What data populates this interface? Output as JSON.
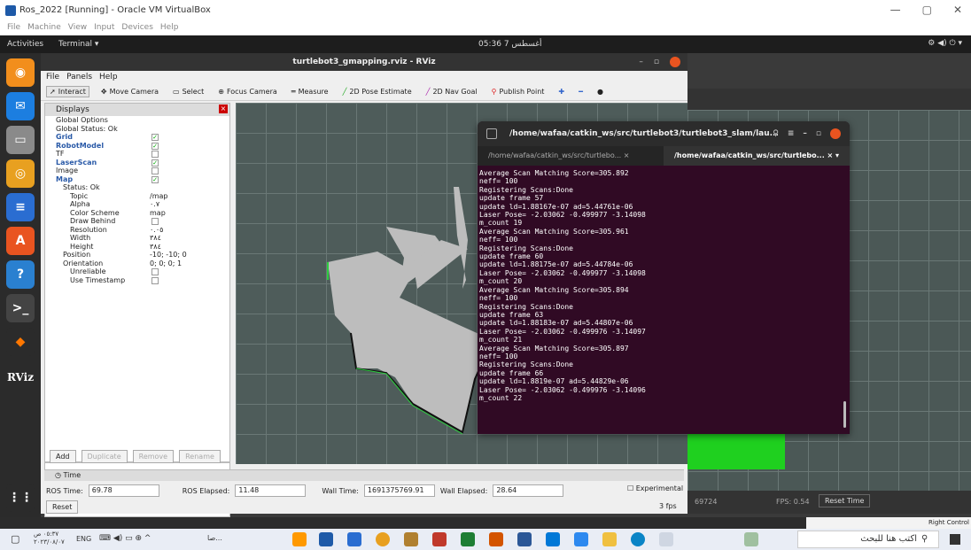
{
  "vbox": {
    "title": "Ros_2022 [Running] - Oracle VM VirtualBox",
    "menu": [
      "File",
      "Machine",
      "View",
      "Input",
      "Devices",
      "Help"
    ]
  },
  "ubuntu_bar": {
    "activities": "Activities",
    "app_menu": "Terminal ▾",
    "clock": "05:36 أغسطس 7",
    "tray": "⚙ ◀) ⏻ ▾"
  },
  "rviz": {
    "title": "turtlebot3_gmapping.rviz - RViz",
    "menu": [
      "File",
      "Panels",
      "Help"
    ],
    "toolbar": [
      "Interact",
      "Move Camera",
      "Select",
      "Focus Camera",
      "Measure",
      "2D Pose Estimate",
      "2D Nav Goal",
      "Publish Point"
    ],
    "displays_title": "Displays",
    "tree": [
      {
        "label": "Global Options",
        "indent": 1,
        "blue": false
      },
      {
        "label": "Global Status: Ok",
        "indent": 1,
        "blue": false
      },
      {
        "label": "Grid",
        "indent": 1,
        "blue": true,
        "check": "✓"
      },
      {
        "label": "RobotModel",
        "indent": 1,
        "blue": true,
        "check": "✓"
      },
      {
        "label": "TF",
        "indent": 1,
        "blue": false,
        "check": ""
      },
      {
        "label": "LaserScan",
        "indent": 1,
        "blue": true,
        "check": "✓"
      },
      {
        "label": "Image",
        "indent": 1,
        "blue": false,
        "check": ""
      },
      {
        "label": "Map",
        "indent": 1,
        "blue": true,
        "check": "✓"
      },
      {
        "label": "Status: Ok",
        "indent": 2,
        "blue": false
      },
      {
        "label": "Topic",
        "indent": 3,
        "value": "/map"
      },
      {
        "label": "Alpha",
        "indent": 3,
        "value": "٠.٧"
      },
      {
        "label": "Color Scheme",
        "indent": 3,
        "value": "map"
      },
      {
        "label": "Draw Behind",
        "indent": 3,
        "check": ""
      },
      {
        "label": "Resolution",
        "indent": 3,
        "value": "٠.٠٥"
      },
      {
        "label": "Width",
        "indent": 3,
        "value": "٣٨٤"
      },
      {
        "label": "Height",
        "indent": 3,
        "value": "٣٨٤"
      },
      {
        "label": "Position",
        "indent": 2,
        "value": "-10; -10; 0"
      },
      {
        "label": "Orientation",
        "indent": 2,
        "value": "0; 0; 0; 1"
      },
      {
        "label": "Unreliable",
        "indent": 3,
        "check": ""
      },
      {
        "label": "Use Timestamp",
        "indent": 3,
        "check": ""
      }
    ],
    "buttons": [
      "Add",
      "Duplicate",
      "Remove",
      "Rename"
    ],
    "time": {
      "title": "Time",
      "ros_time_label": "ROS Time:",
      "ros_time": "69.78",
      "ros_elapsed_label": "ROS Elapsed:",
      "ros_elapsed": "11.48",
      "wall_time_label": "Wall Time:",
      "wall_time": "1691375769.91",
      "wall_elapsed_label": "Wall Elapsed:",
      "wall_elapsed": "28.64",
      "experimental": "Experimental",
      "reset": "Reset",
      "fps": "3 fps"
    }
  },
  "terminal": {
    "title": "/home/wafaa/catkin_ws/src/turtlebot3/turtlebot3_slam/lau...",
    "tabs": [
      "/home/wafaa/catkin_ws/src/turtlebo...",
      "/home/wafaa/catkin_ws/src/turtlebo..."
    ],
    "lines": [
      "Average Scan Matching Score=305.892",
      "neff= 100",
      "Registering Scans:Done",
      "update frame 57",
      "update ld=1.88167e-07 ad=5.44761e-06",
      "Laser Pose= -2.03062 -0.499977 -3.14098",
      "m_count 19",
      "Average Scan Matching Score=305.961",
      "neff= 100",
      "Registering Scans:Done",
      "update frame 60",
      "update ld=1.88175e-07 ad=5.44784e-06",
      "Laser Pose= -2.03062 -0.499977 -3.14098",
      "m_count 20",
      "Average Scan Matching Score=305.894",
      "neff= 100",
      "Registering Scans:Done",
      "update frame 63",
      "update ld=1.88183e-07 ad=5.44807e-06",
      "Laser Pose= -2.03062 -0.499976 -3.14097",
      "m_count 21",
      "Average Scan Matching Score=305.897",
      "neff= 100",
      "Registering Scans:Done",
      "update frame 66",
      "update ld=1.8819e-07 ad=5.44829e-06",
      "Laser Pose= -2.03062 -0.499976 -3.14096",
      "m_count 22"
    ]
  },
  "rviz2": {
    "time_value": "69724",
    "fps": "FPS: 0.54",
    "reset": "Reset Time"
  },
  "taskbar": {
    "lang": "ENG",
    "clock_line1": "٠٥:٣٧ ص",
    "clock_line2": "٢٠٢٣/٠٨/٠٧",
    "search_placeholder": "اكتب هنا للبحث",
    "weather": "صا...",
    "tray_right": "Right Control"
  }
}
